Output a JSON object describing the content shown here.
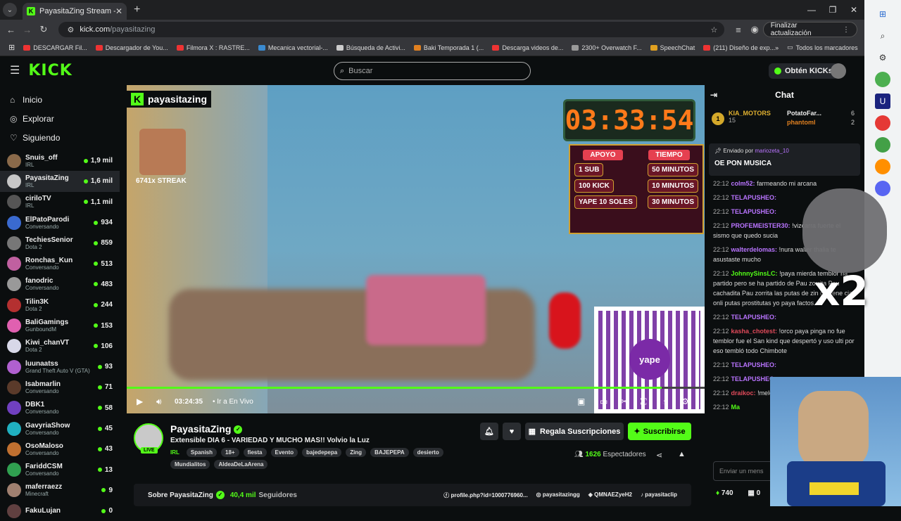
{
  "browser": {
    "tab_title": "PayasitaZing Stream - Watch Li",
    "url_host": "kick.com",
    "url_path": "/payasitazing",
    "update_button": "Finalizar actualización",
    "bookmarks": [
      "DESCARGAR Fil...",
      "Descargador de You...",
      "Filmora X : RASTRE...",
      "Mecanica vectorial-...",
      "Búsqueda de Activi...",
      "Baki Temporada 1 (...",
      "Descarga videos de...",
      "2300+ Overwatch F...",
      "SpeechChat",
      "(211) Diseño de exp..."
    ],
    "all_bookmarks": "Todos los marcadores"
  },
  "header": {
    "logo": "KICK",
    "search_placeholder": "Buscar",
    "kicks_button": "Obtén KICKs"
  },
  "sidebar": {
    "nav": [
      {
        "icon": "home-icon",
        "label": "Inicio"
      },
      {
        "icon": "compass-icon",
        "label": "Explorar"
      },
      {
        "icon": "heart-icon",
        "label": "Siguiendo"
      }
    ],
    "channels": [
      {
        "name": "Snuis_off",
        "sub": "IRL",
        "viewers": "1,9 mil",
        "color": "#8a6a4a"
      },
      {
        "name": "PayasitaZing",
        "sub": "IRL",
        "viewers": "1,6 mil",
        "color": "#c7c7c7"
      },
      {
        "name": "ciriloTV",
        "sub": "IRL",
        "viewers": "1,1 mil",
        "color": "#555"
      },
      {
        "name": "ElPatoParodi",
        "sub": "Conversando",
        "viewers": "934",
        "color": "#3a6ad0"
      },
      {
        "name": "TechiesSenior",
        "sub": "Dota 2",
        "viewers": "859",
        "color": "#777"
      },
      {
        "name": "Ronchas_Kun",
        "sub": "Conversando",
        "viewers": "513",
        "color": "#c060a0"
      },
      {
        "name": "fanodric",
        "sub": "Conversando",
        "viewers": "483",
        "color": "#999"
      },
      {
        "name": "Tilin3K",
        "sub": "Dota 2",
        "viewers": "244",
        "color": "#b43030"
      },
      {
        "name": "BaliGamings",
        "sub": "GunboundM",
        "viewers": "153",
        "color": "#e060b0"
      },
      {
        "name": "Kiwi_chanVT",
        "sub": "Dota 2",
        "viewers": "106",
        "color": "#d8d8e8"
      },
      {
        "name": "luunaatss",
        "sub": "Grand Theft Auto V (GTA)",
        "viewers": "93",
        "color": "#b060d0"
      },
      {
        "name": "Isabmarlin",
        "sub": "Conversando",
        "viewers": "71",
        "color": "#5a3a2a"
      },
      {
        "name": "DBK1",
        "sub": "Conversando",
        "viewers": "58",
        "color": "#7040c0"
      },
      {
        "name": "GavyriaShow",
        "sub": "Conversando",
        "viewers": "45",
        "color": "#20b0c0"
      },
      {
        "name": "OsoMaloso",
        "sub": "Conversando",
        "viewers": "43",
        "color": "#c07030"
      },
      {
        "name": "FariddCSM",
        "sub": "Conversando",
        "viewers": "13",
        "color": "#30a050"
      },
      {
        "name": "maferraezz",
        "sub": "Minecraft",
        "viewers": "9",
        "color": "#a08070"
      },
      {
        "name": "FakuLujan",
        "sub": "",
        "viewers": "0",
        "color": "#604040"
      }
    ]
  },
  "player": {
    "channel_tag": "payasitazing",
    "streak": "6741x STREAK",
    "timer": "03:33:54",
    "rates_head": [
      "APOYO",
      "TIEMPO"
    ],
    "rates": [
      {
        "a": "1 SUB",
        "b": "50 MINUTOS"
      },
      {
        "a": "100 KICK",
        "b": "10 MINUTOS"
      },
      {
        "a": "YAPE 10 SOLES",
        "b": "30 MINUTOS"
      }
    ],
    "qr_label": "yape",
    "time": "03:24:35",
    "live_link": "Ir a En Vivo",
    "progress": 0.926
  },
  "stream": {
    "name": "PayasitaZing",
    "live_badge": "LIVE",
    "title": "Extensible DIA 6 - VARIEDAD Y MUCHO MAS!! Volvio la Luz",
    "category": "IRL",
    "tags": [
      "Spanish",
      "18+",
      "fiesta",
      "Evento",
      "bajedepepa",
      "Zing",
      "BAJEPEPA",
      "desierto",
      "Mundialitos",
      "AldeaDeLaArena"
    ],
    "gift_button": "Regala Suscripciones",
    "subscribe_button": "Suscribirse",
    "viewers": "1626",
    "viewers_label": "Espectadores",
    "about": "Sobre PayasitaZing",
    "followers": "40,4 mil",
    "followers_label": "Seguidores",
    "links": [
      "profile.php?id=1000776960...",
      "payasitazingg",
      "QMNAEZyeH2",
      "payasitaclip"
    ]
  },
  "chat": {
    "title": "Chat",
    "leaders": [
      {
        "name": "KIA_MOTORS",
        "n": "15"
      },
      {
        "name": "PotatoFar...",
        "n": "6"
      },
      {
        "name": "phantoml",
        "n": "2"
      }
    ],
    "pinned_by_label": "Enviado por",
    "pinned_by": "mariozeta_10",
    "pinned_msg": "OE PON MUSICA",
    "messages": [
      {
        "t": "22:12",
        "u": "colm52:",
        "c": "#b974ff",
        "m": "farmeando mi arcana"
      },
      {
        "t": "22:12",
        "u": "TELAPUSHEO:",
        "c": "#b974ff",
        "m": ""
      },
      {
        "t": "22:12",
        "u": "TELAPUSHEO:",
        "c": "#b974ff",
        "m": ""
      },
      {
        "t": "22:12",
        "u": "PROFEMEISTER30:",
        "c": "#b974ff",
        "m": "!vizcarra fuerte el sismo que quedo sucia"
      },
      {
        "t": "22:12",
        "u": "walterdelomas:",
        "c": "#b974ff",
        "m": "!nura walter thalia te asustaste mucho"
      },
      {
        "t": "22:12",
        "u": "JohnnySinsLC:",
        "c": "#53fc18",
        "m": "!paya mierda temblor ha partido pero se ha partido de Pau zorrita Pau cachadita Pau zorrita las putas de zin ga vene cia onli putas prostitutas yo paya factos"
      },
      {
        "t": "22:12",
        "u": "TELAPUSHEO:",
        "c": "#b974ff",
        "m": ""
      },
      {
        "t": "22:12",
        "u": "kasha_chotest:",
        "c": "#e04a5a",
        "m": "!orco paya pinga no fue temblor fue el San kind que despertó y uso ulti por eso tembló todo Chimbote"
      },
      {
        "t": "22:12",
        "u": "TELAPUSHEO:",
        "c": "#b974ff",
        "m": ""
      },
      {
        "t": "22:12",
        "u": "TELAPUSHEO:",
        "c": "#b974ff",
        "m": ""
      },
      {
        "t": "22:12",
        "u": "draikoc:",
        "c": "#e04a5a",
        "m": "!melo rascar al temblor en"
      },
      {
        "t": "22:12",
        "u": "Ma",
        "c": "#53fc18",
        "m": ""
      }
    ],
    "input_placeholder": "Enviar un mens",
    "kicks_count": "740",
    "gift_count": "0"
  },
  "overlay": {
    "x2": "x2"
  },
  "colors": {
    "accent": "#53fc18",
    "bg": "#0b0e0f"
  }
}
